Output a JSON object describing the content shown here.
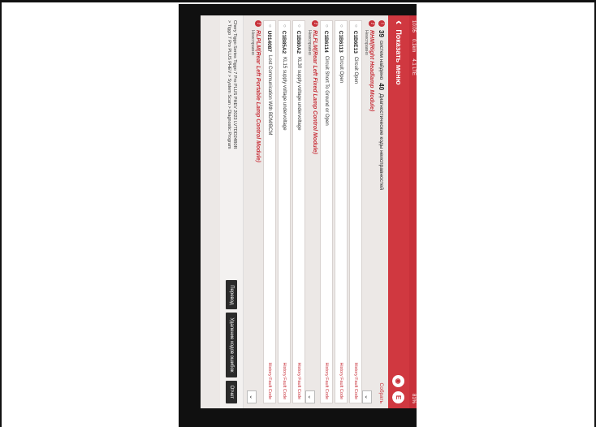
{
  "status_bar": {
    "time": "10:05",
    "left_text": "0.1km",
    "network": "4.1 LTE",
    "battery": "81%"
  },
  "app_bar": {
    "back_icon": "chevron-left-icon",
    "title": "Показать меню",
    "icon1": "logo-circle-icon",
    "icon2": "e-circle-icon"
  },
  "summary": {
    "system_count": "39",
    "text1": "систем найдено",
    "code_count": "40",
    "text2": "Диагностические коды неисправностей",
    "collapse_label": "Собрать"
  },
  "modules": [
    {
      "name": "RHM(Right Headlamp Module)",
      "status": "Неисправно",
      "codes": [
        {
          "code": "C1B6E13",
          "description": "Circuit Open",
          "type": "History Fault Code"
        },
        {
          "code": "C1B6113",
          "description": "Circuit Open",
          "type": "History Fault Code"
        },
        {
          "code": "C1B6114",
          "description": "Circuit Short To Ground or Open",
          "type": "History Fault Code"
        }
      ]
    },
    {
      "name": "RLFLM(Rear Left Fixed Lamp Control Module)",
      "status": "Неисправно",
      "codes": [
        {
          "code": "C1B80A2",
          "description": "KL30 supply voltage undervoltage",
          "type": "History Fault Code"
        },
        {
          "code": "C1B85A2",
          "description": "KL15 supply voltage undervoltage",
          "type": "History Fault Code"
        },
        {
          "code": "U014087",
          "description": "Lost Communication With BDM/BCM",
          "type": "History Fault Code"
        }
      ]
    },
    {
      "name": "RLPLM(Rear Left Portable Lamp Control Module)",
      "status": "Неисправно",
      "codes": []
    }
  ],
  "footer": {
    "path_line1": "Chery Tiggo Series Tiggo 7 Pro PLUS PHEV 2023 LVTDD24B0R",
    "path_line2": "> Tiggo 7 Pro PLUS PHEV > System Scan > Diagnostic Program",
    "btn_translate": "Перевод",
    "btn_clear": "Удаление кодов ошибок",
    "btn_report": "Отчет"
  }
}
